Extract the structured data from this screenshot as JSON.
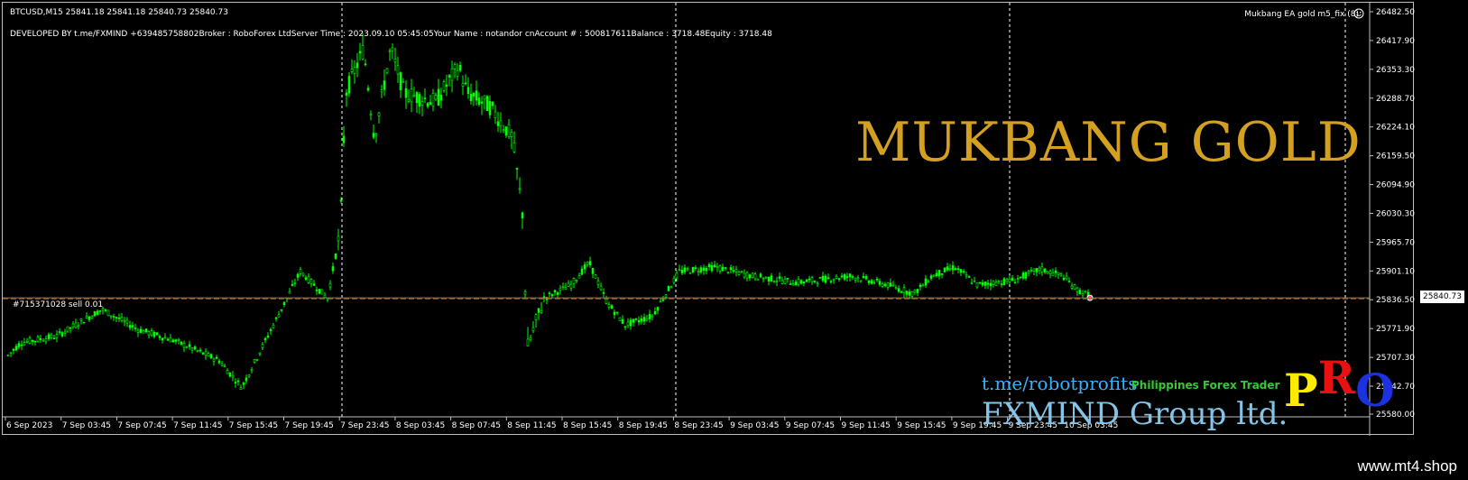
{
  "header": {
    "symbol": "BTCUSD,M15  25841.18 25841.18 25840.73 25840.73",
    "info": "DEVELOPED BY t.me/FXMIND  +639485758802Broker  : RoboForex LtdServer Time : 2023.09.10 05:45:05Your Name    : notandor cnAccount #  : 500817611Balance : 3718.48Equity   : 3718.48",
    "ea_name": "Mukbang EA gold m5_fix (8)",
    "ea_icon": "smiley-icon"
  },
  "overlay": {
    "title": "MUKBANG GOLD",
    "telegram": "t.me/robotprofits",
    "tagline": "Philippines Forex Trader",
    "brand": "FXMIND Group ltd.",
    "pro_p": "P",
    "pro_r": "R",
    "pro_o": "O"
  },
  "order": {
    "label": "#715371028 sell 0.01"
  },
  "current_price": "25840.73",
  "price_axis": [
    "26482.50",
    "26417.90",
    "26353.30",
    "26288.70",
    "26224.10",
    "26159.50",
    "26094.90",
    "26030.30",
    "25965.70",
    "25901.10",
    "25836.50",
    "25771.90",
    "25707.30",
    "25642.70",
    "25580.00"
  ],
  "time_axis": [
    "6 Sep 2023",
    "7 Sep 03:45",
    "7 Sep 07:45",
    "7 Sep 11:45",
    "7 Sep 15:45",
    "7 Sep 19:45",
    "7 Sep 23:45",
    "8 Sep 03:45",
    "8 Sep 07:45",
    "8 Sep 11:45",
    "8 Sep 15:45",
    "8 Sep 19:45",
    "8 Sep 23:45",
    "9 Sep 03:45",
    "9 Sep 07:45",
    "9 Sep 11:45",
    "9 Sep 15:45",
    "9 Sep 19:45",
    "9 Sep 23:45",
    "10 Sep 03:45"
  ],
  "footer": {
    "site": "www.mt4.shop"
  },
  "colors": {
    "bull": "#00ff00",
    "bear": "#00ff00",
    "order_line": "#d06a00",
    "price_line": "#808080",
    "title": "#d4a020"
  }
}
